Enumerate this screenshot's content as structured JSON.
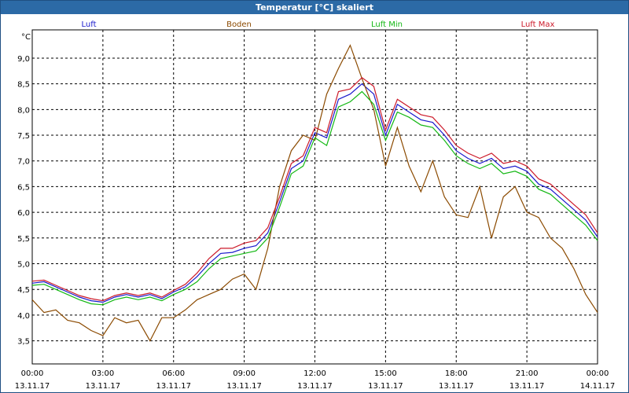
{
  "window": {
    "title": "Temperatur [°C] skaliert"
  },
  "chart_data": {
    "type": "line",
    "title": "Temperatur [°C] skaliert",
    "ylabel": "°C",
    "xlabel": "",
    "ylim": [
      3.05,
      9.55
    ],
    "xlim": [
      0,
      24
    ],
    "grid": true,
    "yticks": [
      3.5,
      4.0,
      4.5,
      5.0,
      5.5,
      6.0,
      6.5,
      7.0,
      7.5,
      8.0,
      8.5,
      9.0
    ],
    "ytick_labels": [
      "3,5",
      "4,0",
      "4,5",
      "5,0",
      "5,5",
      "6,0",
      "6,5",
      "7,0",
      "7,5",
      "8,0",
      "8,5",
      "9,0"
    ],
    "xticks": [
      {
        "t": 0,
        "time": "00:00",
        "date": "13.11.17"
      },
      {
        "t": 3,
        "time": "03:00",
        "date": "13.11.17"
      },
      {
        "t": 6,
        "time": "06:00",
        "date": "13.11.17"
      },
      {
        "t": 9,
        "time": "09:00",
        "date": "13.11.17"
      },
      {
        "t": 12,
        "time": "12:00",
        "date": "13.11.17"
      },
      {
        "t": 15,
        "time": "15:00",
        "date": "13.11.17"
      },
      {
        "t": 18,
        "time": "18:00",
        "date": "13.11.17"
      },
      {
        "t": 21,
        "time": "21:00",
        "date": "13.11.17"
      },
      {
        "t": 24,
        "time": "00:00",
        "date": "14.11.17"
      }
    ],
    "legend": [
      {
        "name": "Luft",
        "color": "#1a1acc"
      },
      {
        "name": "Boden",
        "color": "#8b4a00"
      },
      {
        "name": "Luft Min",
        "color": "#14b814"
      },
      {
        "name": "Luft Max",
        "color": "#cc1a2a"
      }
    ],
    "x": [
      0,
      0.5,
      1,
      1.5,
      2,
      2.5,
      3,
      3.5,
      4,
      4.5,
      5,
      5.5,
      6,
      6.5,
      7,
      7.5,
      8,
      8.5,
      9,
      9.5,
      10,
      10.5,
      11,
      11.5,
      12,
      12.5,
      13,
      13.5,
      14,
      14.5,
      15,
      15.5,
      16,
      16.5,
      17,
      17.5,
      18,
      18.5,
      19,
      19.5,
      20,
      20.5,
      21,
      21.5,
      22,
      22.5,
      23,
      23.5,
      24
    ],
    "series": [
      {
        "name": "Luft",
        "color": "#1a1acc",
        "values": [
          4.62,
          4.65,
          4.55,
          4.45,
          4.35,
          4.28,
          4.25,
          4.35,
          4.4,
          4.35,
          4.4,
          4.32,
          4.45,
          4.55,
          4.75,
          5.0,
          5.2,
          5.22,
          5.3,
          5.35,
          5.6,
          6.2,
          6.85,
          7.0,
          7.55,
          7.45,
          8.2,
          8.3,
          8.5,
          8.3,
          7.5,
          8.1,
          7.95,
          7.8,
          7.75,
          7.5,
          7.2,
          7.05,
          6.95,
          7.05,
          6.85,
          6.9,
          6.8,
          6.55,
          6.45,
          6.25,
          6.05,
          5.85,
          5.52
        ]
      },
      {
        "name": "Boden",
        "color": "#8b4a00",
        "values": [
          4.3,
          4.05,
          4.1,
          3.9,
          3.85,
          3.7,
          3.6,
          3.95,
          3.85,
          3.9,
          3.5,
          3.95,
          3.95,
          4.1,
          4.3,
          4.4,
          4.5,
          4.7,
          4.8,
          4.5,
          5.3,
          6.5,
          7.2,
          7.5,
          7.4,
          8.3,
          8.8,
          9.25,
          8.6,
          8.0,
          6.9,
          7.65,
          6.9,
          6.4,
          7.0,
          6.3,
          5.95,
          5.9,
          6.5,
          5.5,
          6.3,
          6.5,
          6.0,
          5.9,
          5.5,
          5.3,
          4.9,
          4.4,
          4.05
        ]
      },
      {
        "name": "Luft Min",
        "color": "#14b814",
        "values": [
          4.58,
          4.6,
          4.5,
          4.4,
          4.3,
          4.22,
          4.2,
          4.3,
          4.35,
          4.3,
          4.35,
          4.28,
          4.4,
          4.5,
          4.65,
          4.9,
          5.1,
          5.15,
          5.2,
          5.25,
          5.5,
          6.1,
          6.75,
          6.9,
          7.45,
          7.3,
          8.05,
          8.15,
          8.35,
          8.1,
          7.4,
          7.95,
          7.85,
          7.7,
          7.65,
          7.4,
          7.1,
          6.95,
          6.85,
          6.95,
          6.75,
          6.8,
          6.7,
          6.45,
          6.35,
          6.15,
          5.95,
          5.75,
          5.45
        ]
      },
      {
        "name": "Luft Max",
        "color": "#cc1a2a",
        "values": [
          4.66,
          4.68,
          4.58,
          4.48,
          4.38,
          4.32,
          4.28,
          4.38,
          4.43,
          4.38,
          4.43,
          4.35,
          4.48,
          4.6,
          4.82,
          5.1,
          5.3,
          5.3,
          5.4,
          5.45,
          5.7,
          6.3,
          6.95,
          7.1,
          7.65,
          7.55,
          8.35,
          8.4,
          8.62,
          8.45,
          7.6,
          8.2,
          8.05,
          7.9,
          7.85,
          7.6,
          7.3,
          7.15,
          7.05,
          7.15,
          6.95,
          7.0,
          6.9,
          6.65,
          6.55,
          6.35,
          6.15,
          5.95,
          5.6
        ]
      }
    ]
  }
}
